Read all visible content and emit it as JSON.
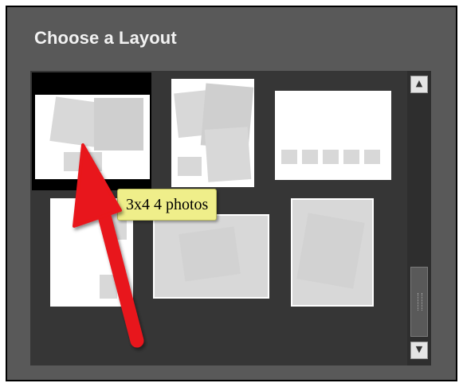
{
  "panel": {
    "title": "Choose a Layout"
  },
  "layouts": [
    {
      "name": "layout-1",
      "selected": true,
      "tooltip": "3x4 4 photos"
    },
    {
      "name": "layout-2",
      "selected": false
    },
    {
      "name": "layout-3",
      "selected": false
    },
    {
      "name": "layout-4",
      "selected": false
    },
    {
      "name": "layout-5",
      "selected": false
    },
    {
      "name": "layout-6",
      "selected": false
    }
  ],
  "tooltip": {
    "text": "3x4 4 photos"
  },
  "scrollbar": {
    "up_icon": "chevron-up-icon",
    "down_icon": "chevron-down-icon",
    "up_glyph": "▲",
    "down_glyph": "▼"
  },
  "colors": {
    "panel_bg": "#595959",
    "grid_bg": "#363636",
    "selection": "#000000",
    "tooltip_bg": "#efee8a",
    "annotation_arrow": "#e8141a"
  }
}
